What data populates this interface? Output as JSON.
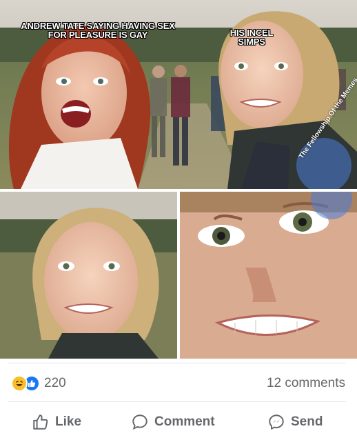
{
  "meme": {
    "caption_left": "ANDREW TATE SAYING HAVING SEX FOR PLEASURE IS GAY",
    "caption_right": "HIS INCEL SIMPS",
    "watermark": "The Fellowship Of the Memes"
  },
  "post": {
    "reaction_count": "220",
    "comments_count": "12 comments",
    "reaction_icons": [
      "haha-icon",
      "like-icon"
    ]
  },
  "actions": {
    "like": "Like",
    "comment": "Comment",
    "send": "Send"
  },
  "colors": {
    "muted_text": "#65676b",
    "like_blue": "#1877f2",
    "haha_yellow": "#f7c02b",
    "divider": "#e4e6ea"
  }
}
